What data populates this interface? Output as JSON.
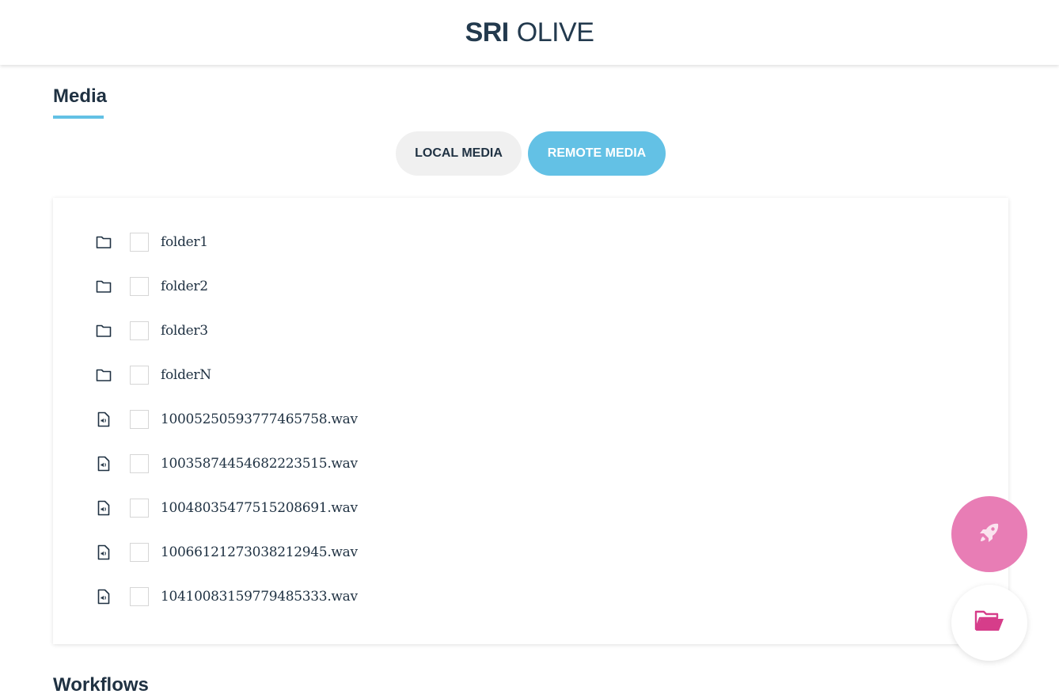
{
  "header": {
    "logo_bold": "SRI",
    "logo_light": "OLIVE"
  },
  "media": {
    "title": "Media",
    "toggle": {
      "local_label": "LOCAL MEDIA",
      "remote_label": "REMOTE MEDIA",
      "active": "remote"
    },
    "items": [
      {
        "type": "folder",
        "icon": "folder-icon",
        "name": "folder1",
        "checked": false
      },
      {
        "type": "folder",
        "icon": "folder-icon",
        "name": "folder2",
        "checked": false
      },
      {
        "type": "folder",
        "icon": "folder-icon",
        "name": "folder3",
        "checked": false
      },
      {
        "type": "folder",
        "icon": "folder-icon",
        "name": "folderN",
        "checked": false
      },
      {
        "type": "audio",
        "icon": "audio-file-icon",
        "name": "10005250593777465758.wav",
        "checked": false
      },
      {
        "type": "audio",
        "icon": "audio-file-icon",
        "name": "10035874454682223515.wav",
        "checked": false
      },
      {
        "type": "audio",
        "icon": "audio-file-icon",
        "name": "10048035477515208691.wav",
        "checked": false
      },
      {
        "type": "audio",
        "icon": "audio-file-icon",
        "name": "10066121273038212945.wav",
        "checked": false
      },
      {
        "type": "audio",
        "icon": "audio-file-icon",
        "name": "10410083159779485333.wav",
        "checked": false
      }
    ]
  },
  "workflows": {
    "title": "Workflows"
  },
  "fabs": [
    {
      "icon": "rocket-icon",
      "color": "#e87db5"
    },
    {
      "icon": "folder-open-icon",
      "color": "#d63d8a"
    }
  ],
  "colors": {
    "accent": "#63c1e5",
    "text": "#1f3142",
    "pink": "#e87db5"
  }
}
